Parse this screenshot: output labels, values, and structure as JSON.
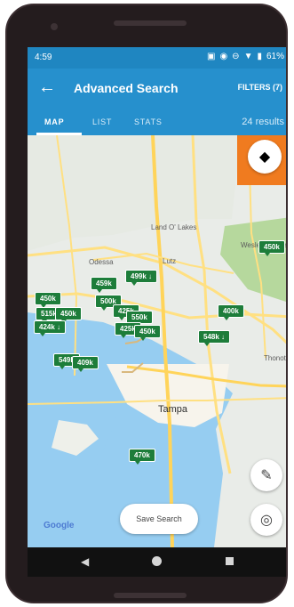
{
  "status": {
    "time": "4:59",
    "battery": "61%"
  },
  "app": {
    "title": "Advanced Search",
    "filters_label": "FILTERS (7)"
  },
  "tabs": {
    "map": "MAP",
    "list": "LIST",
    "stats": "STATS",
    "results": "24 results"
  },
  "map": {
    "places": [
      "Land O' Lakes",
      "Wesley Chapel",
      "Odessa",
      "Lutz",
      "Thonotosassa",
      "Tampa"
    ],
    "price_pins": [
      "450k",
      "499k",
      "459k",
      "500k",
      "450k",
      "515k",
      "450k",
      "424k",
      "425k",
      "550k",
      "425k",
      "450k",
      "400k",
      "548k",
      "549k",
      "409k",
      "470k"
    ],
    "down_arrow_pins": [
      "499k",
      "424k",
      "548k"
    ]
  },
  "actions": {
    "save_search": "Save Search",
    "attribution": "Google"
  },
  "colors": {
    "primary": "#2690cd",
    "pin": "#1d7d3a",
    "highlight": "#f07b1f"
  },
  "icons": [
    "back-arrow-icon",
    "layers-icon",
    "pencil-icon",
    "my-location-icon",
    "nav-back-icon",
    "nav-home-icon",
    "nav-recent-icon",
    "down-arrow-icon"
  ]
}
